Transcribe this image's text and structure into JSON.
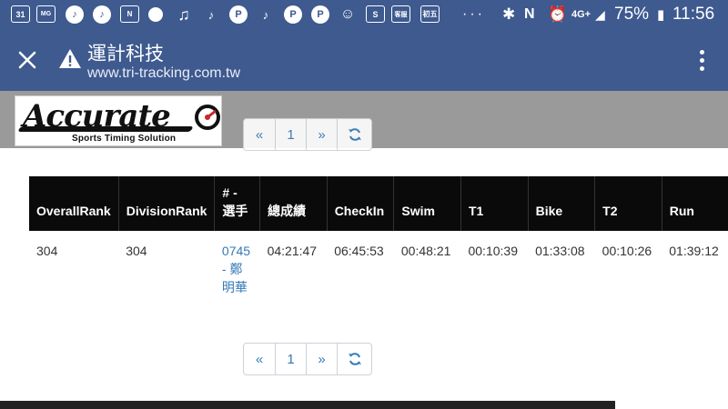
{
  "status_bar": {
    "date": "31",
    "battery": "75%",
    "time": "11:56",
    "network": "4G+"
  },
  "browser": {
    "title": "運計科技",
    "url": "www.tri-tracking.com.tw"
  },
  "logo": {
    "word": "Accurate",
    "tagline": "Sports Timing Solution"
  },
  "pager": {
    "first": "«",
    "page": "1",
    "next": "»",
    "refresh": "↻"
  },
  "table": {
    "headers": [
      "OverallRank",
      "DivisionRank",
      "# - 選手",
      "總成績",
      "CheckIn",
      "Swim",
      "T1",
      "Bike",
      "T2",
      "Run"
    ],
    "rows": [
      {
        "overall_rank": "304",
        "division_rank": "304",
        "athlete": "0745 - 鄭明華",
        "total": "04:21:47",
        "checkin": "06:45:53",
        "swim": "00:48:21",
        "t1": "00:10:39",
        "bike": "01:33:08",
        "t2": "00:10:26",
        "run": "01:39:12"
      }
    ]
  },
  "colors": {
    "status_bar": "#3e5a8f",
    "table_header": "#0a0a0a",
    "link": "#337ab7"
  }
}
